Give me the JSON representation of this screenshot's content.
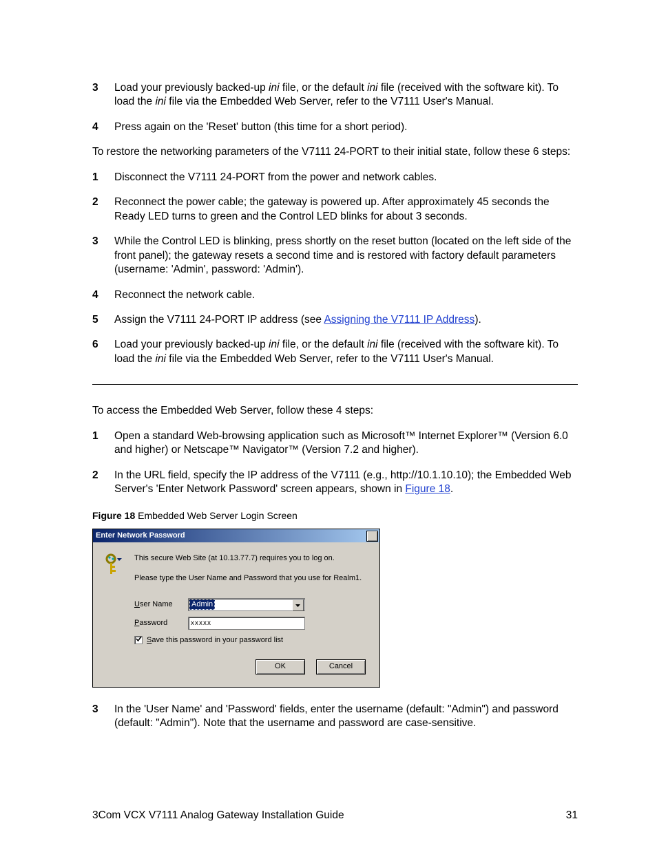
{
  "listA": {
    "items": [
      {
        "n": "3",
        "t_pre": "Load your previously backed-up ",
        "ini1": "ini",
        "t_mid": " file, or the default ",
        "ini2": "ini",
        "t_mid2": " file (received with the software kit). To load the ",
        "ini3": "ini",
        "t_post": " file via the Embedded Web Server, refer to the V7111 User's Manual."
      },
      {
        "n": "4",
        "t": "Press again on the 'Reset' button (this time for a short period)."
      }
    ]
  },
  "para1": "To restore the networking parameters of the V7111 24-PORT to their initial state, follow these 6 steps:",
  "listB": {
    "items": [
      {
        "n": "1",
        "t": "Disconnect the V7111 24-PORT from the power and network cables."
      },
      {
        "n": "2",
        "t": "Reconnect the power cable; the gateway is powered up. After approximately 45 seconds the Ready LED turns to green and the Control LED blinks for about 3 seconds."
      },
      {
        "n": "3",
        "t": "While the Control LED is blinking, press shortly on the reset button (located on the left side of the front panel); the gateway resets a second time and is restored with factory default parameters (username: 'Admin', password: 'Admin')."
      },
      {
        "n": "4",
        "t": "Reconnect the network cable."
      },
      {
        "n": "5",
        "t_pre": "Assign the V7111 24-PORT IP address (see ",
        "link": "Assigning the V7111 IP Address",
        "t_post": ")."
      },
      {
        "n": "6",
        "t_pre": "Load your previously backed-up ",
        "ini1": "ini",
        "t_mid": " file, or the default ",
        "ini2": "ini",
        "t_mid2": " file (received with the software kit). To load the ",
        "ini3": "ini",
        "t_post": " file via the Embedded Web Server, refer to the V7111 User's Manual."
      }
    ]
  },
  "para2": "To access the Embedded Web Server, follow these 4 steps:",
  "listC": {
    "items": [
      {
        "n": "1",
        "t": "Open a standard Web-browsing application such as Microsoft™ Internet Explorer™ (Version 6.0 and higher) or Netscape™ Navigator™ (Version 7.2 and higher)."
      },
      {
        "n": "2",
        "t_pre": "In the URL field, specify the IP address of the V7111 (e.g., http://10.1.10.10); the Embedded Web Server's 'Enter Network Password' screen appears, shown in ",
        "link": "Figure 18",
        "t_post": "."
      }
    ]
  },
  "figCaption": {
    "bold": "Figure 18",
    "rest": "   Embedded Web Server Login Screen"
  },
  "dialog": {
    "title": "Enter Network Password",
    "line1": "This secure Web Site (at 10.13.77.7) requires you to log on.",
    "line2": "Please type the User Name and Password that you use for Realm1.",
    "user_label_u": "U",
    "user_label_rest": "ser Name",
    "user_value": "Admin",
    "pass_label_u": "P",
    "pass_label_rest": "assword",
    "pass_value": "xxxxx",
    "save_u": "S",
    "save_rest": "ave this password in your password list",
    "ok": "OK",
    "cancel": "Cancel"
  },
  "listD": {
    "items": [
      {
        "n": "3",
        "t": "In the 'User Name' and 'Password' fields, enter the username (default: \"Admin\") and password (default: \"Admin\"). Note that the username and password are case-sensitive."
      }
    ]
  },
  "footer": {
    "left": "3Com VCX V7111 Analog Gateway Installation Guide",
    "right": "31"
  }
}
